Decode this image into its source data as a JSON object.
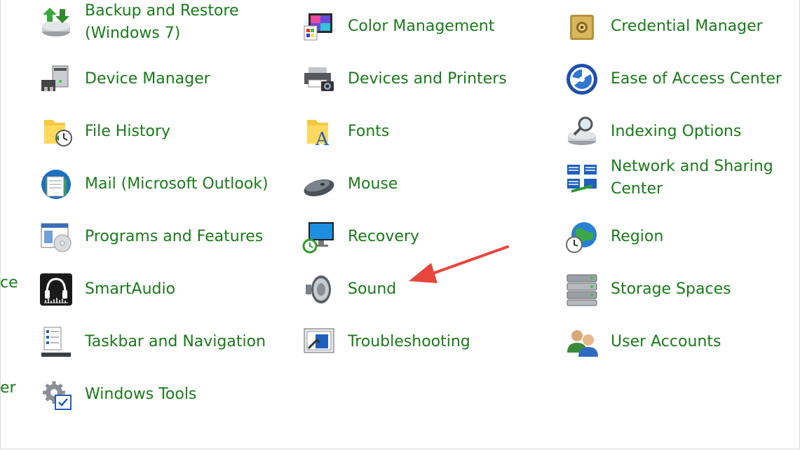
{
  "clipped_left": [
    "ce",
    "er"
  ],
  "items": [
    {
      "label": "Backup and Restore (Windows 7)",
      "icon": "backup-restore-icon"
    },
    {
      "label": "Color Management",
      "icon": "color-management-icon"
    },
    {
      "label": "Credential Manager",
      "icon": "credential-manager-icon"
    },
    {
      "label": "Device Manager",
      "icon": "device-manager-icon"
    },
    {
      "label": "Devices and Printers",
      "icon": "devices-printers-icon"
    },
    {
      "label": "Ease of Access Center",
      "icon": "ease-of-access-icon"
    },
    {
      "label": "File History",
      "icon": "file-history-icon"
    },
    {
      "label": "Fonts",
      "icon": "fonts-icon"
    },
    {
      "label": "Indexing Options",
      "icon": "indexing-options-icon"
    },
    {
      "label": "Mail (Microsoft Outlook)",
      "icon": "mail-icon"
    },
    {
      "label": "Mouse",
      "icon": "mouse-icon"
    },
    {
      "label": "Network and Sharing Center",
      "icon": "network-sharing-icon"
    },
    {
      "label": "Programs and Features",
      "icon": "programs-features-icon"
    },
    {
      "label": "Recovery",
      "icon": "recovery-icon"
    },
    {
      "label": "Region",
      "icon": "region-icon"
    },
    {
      "label": "SmartAudio",
      "icon": "smartaudio-icon"
    },
    {
      "label": "Sound",
      "icon": "sound-icon"
    },
    {
      "label": "Storage Spaces",
      "icon": "storage-spaces-icon"
    },
    {
      "label": "Taskbar and Navigation",
      "icon": "taskbar-navigation-icon"
    },
    {
      "label": "Troubleshooting",
      "icon": "troubleshooting-icon"
    },
    {
      "label": "User Accounts",
      "icon": "user-accounts-icon"
    },
    {
      "label": "Windows Tools",
      "icon": "windows-tools-icon"
    }
  ],
  "colors": {
    "link": "#1a7a1a",
    "arrow": "#e8453c"
  }
}
